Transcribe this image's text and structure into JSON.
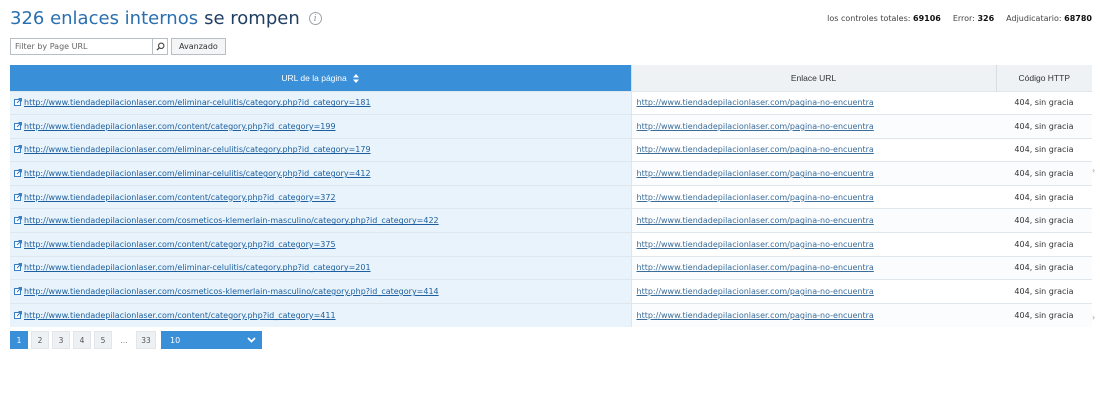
{
  "header": {
    "count": "326 enlaces internos",
    "title_rest": "se rompen",
    "info_icon": "info-icon"
  },
  "stats": {
    "total_label": "los controles totales:",
    "total_value": "69106",
    "error_label": "Error:",
    "error_value": "326",
    "awarded_label": "Adjudicatario:",
    "awarded_value": "68780"
  },
  "filter": {
    "placeholder": "Filter by Page URL",
    "value": "",
    "search_icon": "search-icon",
    "advanced_label": "Avanzado"
  },
  "table": {
    "columns": {
      "page_url": "URL de la página",
      "link_url": "Enlace URL",
      "http_code": "Código HTTP"
    },
    "rows": [
      {
        "page_url": "http://www.tiendadepilacionlaser.com/eliminar-celulitis/category.php?id_category=181",
        "link_url": "http://www.tiendadepilacionlaser.com/pagina-no-encuentra",
        "http_code": "404, sin gracia"
      },
      {
        "page_url": "http://www.tiendadepilacionlaser.com/content/category.php?id_category=199",
        "link_url": "http://www.tiendadepilacionlaser.com/pagina-no-encuentra",
        "http_code": "404, sin gracia"
      },
      {
        "page_url": "http://www.tiendadepilacionlaser.com/eliminar-celulitis/category.php?id_category=179",
        "link_url": "http://www.tiendadepilacionlaser.com/pagina-no-encuentra",
        "http_code": "404, sin gracia"
      },
      {
        "page_url": "http://www.tiendadepilacionlaser.com/eliminar-celulitis/category.php?id_category=412",
        "link_url": "http://www.tiendadepilacionlaser.com/pagina-no-encuentra",
        "http_code": "404, sin gracia"
      },
      {
        "page_url": "http://www.tiendadepilacionlaser.com/content/category.php?id_category=372",
        "link_url": "http://www.tiendadepilacionlaser.com/pagina-no-encuentra",
        "http_code": "404, sin gracia"
      },
      {
        "page_url": "http://www.tiendadepilacionlaser.com/cosmeticos-klemerlain-masculino/category.php?id_category=422",
        "link_url": "http://www.tiendadepilacionlaser.com/pagina-no-encuentra",
        "http_code": "404, sin gracia"
      },
      {
        "page_url": "http://www.tiendadepilacionlaser.com/content/category.php?id_category=375",
        "link_url": "http://www.tiendadepilacionlaser.com/pagina-no-encuentra",
        "http_code": "404, sin gracia"
      },
      {
        "page_url": "http://www.tiendadepilacionlaser.com/eliminar-celulitis/category.php?id_category=201",
        "link_url": "http://www.tiendadepilacionlaser.com/pagina-no-encuentra",
        "http_code": "404, sin gracia"
      },
      {
        "page_url": "http://www.tiendadepilacionlaser.com/cosmeticos-klemerlain-masculino/category.php?id_category=414",
        "link_url": "http://www.tiendadepilacionlaser.com/pagina-no-encuentra",
        "http_code": "404, sin gracia"
      },
      {
        "page_url": "http://www.tiendadepilacionlaser.com/content/category.php?id_category=411",
        "link_url": "http://www.tiendadepilacionlaser.com/pagina-no-encuentra",
        "http_code": "404, sin gracia"
      }
    ]
  },
  "pagination": {
    "pages": [
      "1",
      "2",
      "3",
      "4",
      "5",
      "...",
      "33"
    ],
    "active": "1",
    "per_page": "10",
    "dropdown_icon": "chevron-down-icon"
  },
  "colors": {
    "accent": "#3a8fd9",
    "title_count": "#2a6fb0",
    "link": "#1d5f9e"
  }
}
